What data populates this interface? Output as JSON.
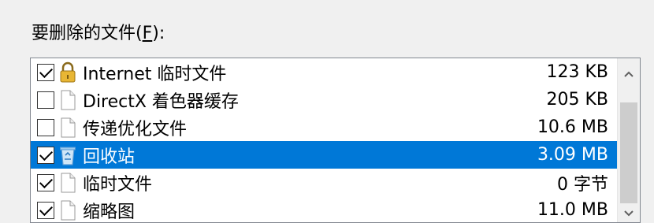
{
  "files_label": {
    "text": "要删除的文件(",
    "accel": "F",
    "suffix": "):"
  },
  "items": [
    {
      "name": "Internet 临时文件",
      "size": "123 KB",
      "checked": true,
      "icon": "lock-icon"
    },
    {
      "name": "DirectX 着色器缓存",
      "size": "205 KB",
      "checked": false,
      "icon": "document-icon"
    },
    {
      "name": "传递优化文件",
      "size": "10.6 MB",
      "checked": false,
      "icon": "document-icon"
    },
    {
      "name": "回收站",
      "size": "3.09 MB",
      "checked": true,
      "icon": "recycle-bin-icon",
      "selected": true
    },
    {
      "name": "临时文件",
      "size": "0 字节",
      "checked": true,
      "icon": "document-icon"
    },
    {
      "name": "缩略图",
      "size": "11.0 MB",
      "checked": true,
      "icon": "document-icon"
    }
  ],
  "colors": {
    "selection": "#0078d7",
    "border": "#828790",
    "thumb": "#cdcdcd"
  }
}
